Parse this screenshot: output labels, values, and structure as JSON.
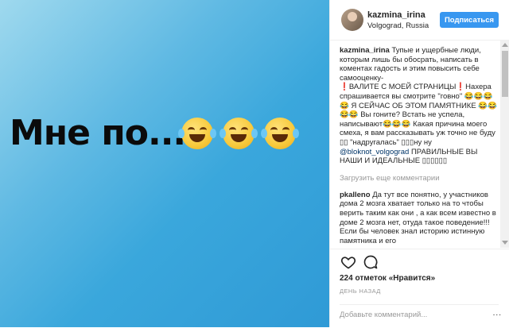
{
  "photo": {
    "caption_text": "Мне по...",
    "emoji_name": "face-with-tears-of-joy"
  },
  "header": {
    "username": "kazmina_irina",
    "location": "Volgograd, Russia",
    "follow_label": "Подписаться"
  },
  "post_comment": {
    "username": "kazmina_irina",
    "text_1": "Тупые и ущербные люди, которым лишь бы обосрать, написать в коментах гадость и этим повысить себе самооценку-",
    "text_2": "❗ВАЛИТЕ С МОЕЙ СТРАНИЦЫ❗Нахера спрашивается вы смотрите \"говно\" 😂😂😂😂 Я СЕЙЧАС ОБ ЭТОМ ПАМЯТНИКЕ 😂😂😂😂 Вы гоните? Встать не успела, написывают😂😂😂 Какая причина моего смеха, я вам рассказывать уж точно не буду ▯▯ \"надругалась\" ▯▯▯ну ну",
    "mention": "@bloknot_volgograd",
    "text_3": "ПРАВИЛЬНЫЕ ВЫ НАШИ И ИДЕАЛЬНЫЕ ▯▯▯▯▯▯"
  },
  "load_more_label": "Загрузить еще комментарии",
  "comment_2": {
    "username": "pkalleno",
    "text": "Да тут все понятно, у участников дома 2 мозга хватает только на то чтобы верить таким как они , а как всем известно в доме 2 мозга нет, отуда такое поведение!!! Если бы человек знал историю истинную памятника и его"
  },
  "actions": {
    "likes": "224 отметок «Нравится»",
    "date": "ДЕНЬ НАЗАД",
    "add_comment_placeholder": "Добавьте комментарий...",
    "more_dots": "..."
  },
  "colors": {
    "follow": "#3897f0",
    "photo_bg": "#3aa7dc",
    "mention": "#003569"
  }
}
